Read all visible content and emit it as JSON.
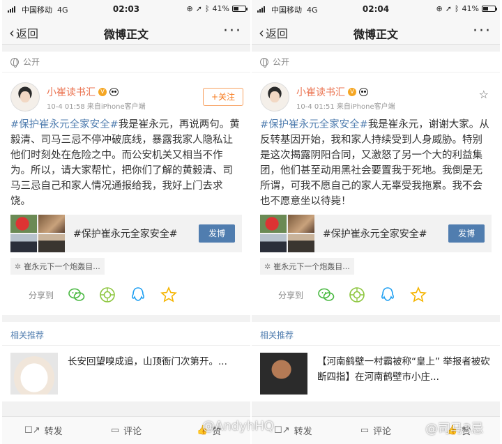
{
  "panels": [
    {
      "status": {
        "carrier": "中国移动",
        "network": "4G",
        "time": "02:03",
        "battery": "41%",
        "battery_level": 0.41
      },
      "nav": {
        "back": "返回",
        "title": "微博正文",
        "more": "···"
      },
      "visibility": "公开",
      "post": {
        "user": "小崔读书汇",
        "meta": "10-4 01:58  来自iPhone客户端",
        "action": "+关注",
        "hashtag": "#保护崔永元全家安全#",
        "text": "我是崔永元，再说两句。黄毅清、司马三忌不停冲破底线，暴露我家人隐私让他们时刻处在危险之中。而公安机关又相当不作为。所以，请大家帮忙，把你们了解的黄毅清、司马三忌自己和家人情况通报给我，我好上门去求饶。"
      },
      "share_card": {
        "title": "#保护崔永元全家安全#",
        "button": "发博"
      },
      "topic_chip": "崔永元下一个炮轰目...",
      "share": {
        "label": "分享到"
      },
      "related": {
        "title": "相关推荐",
        "item": "长安回望嗅成追，山顶衙门次第开。..."
      },
      "bottom": {
        "repost": "转发",
        "comment": "评论",
        "like": "赞"
      }
    },
    {
      "status": {
        "carrier": "中国移动",
        "network": "4G",
        "time": "02:04",
        "battery": "41%",
        "battery_level": 0.41
      },
      "nav": {
        "back": "返回",
        "title": "微博正文",
        "more": "···"
      },
      "visibility": "公开",
      "post": {
        "user": "小崔读书汇",
        "meta": "10-4 01:51  来自iPhone客户端",
        "hashtag": "#保护崔永元全家安全#",
        "text": "我是崔永元，谢谢大家。从反转基因开始，我和家人持续受到人身威胁。特别是这次揭露阴阳合同，又激怒了另一个大的利益集团，他们甚至动用黑社会要置我于死地。我倒是无所谓，可我不愿自己的家人无辜受我拖累。我不会也不愿意坐以待毙！"
      },
      "share_card": {
        "title": "#保护崔永元全家安全#",
        "button": "发博"
      },
      "topic_chip": "崔永元下一个炮轰目...",
      "share": {
        "label": "分享到"
      },
      "related": {
        "title": "相关推荐",
        "item": "【河南鹤壁一村霸被称“皇上” 举报者被砍断四指】在河南鹤壁市小庄..."
      },
      "bottom": {
        "repost": "转发",
        "comment": "评论",
        "like": "赞"
      }
    }
  ],
  "watermarks": [
    "@AndyhHQ",
    "@司马3忌"
  ],
  "colors": {
    "accent": "#eb7350",
    "link": "#507daf",
    "button": "#507daf"
  }
}
